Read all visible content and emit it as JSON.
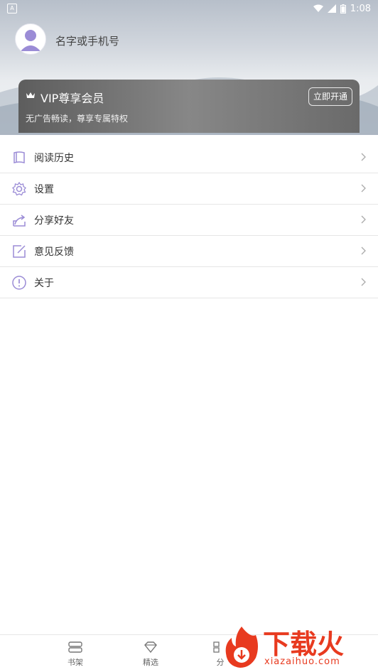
{
  "status_bar": {
    "time": "1:08",
    "app_badge": "A"
  },
  "profile": {
    "name": "名字或手机号"
  },
  "vip": {
    "title": "VIP尊享会员",
    "description": "无广告畅读，尊享专属特权",
    "button_label": "立即开通"
  },
  "menu": {
    "items": [
      {
        "label": "阅读历史",
        "icon": "book-icon"
      },
      {
        "label": "设置",
        "icon": "gear-icon"
      },
      {
        "label": "分享好友",
        "icon": "share-icon"
      },
      {
        "label": "意见反馈",
        "icon": "edit-icon"
      },
      {
        "label": "关于",
        "icon": "info-icon"
      }
    ]
  },
  "bottom_nav": {
    "items": [
      {
        "label": "书架",
        "icon": "bookshelf-icon"
      },
      {
        "label": "精选",
        "icon": "diamond-icon"
      },
      {
        "label": "分",
        "icon": "category-icon"
      }
    ]
  },
  "watermark": {
    "text": "下载火",
    "subtext": "xiazaihuo.com"
  },
  "colors": {
    "accent": "#9b8cd6",
    "watermark": "#e83a1f",
    "vip_card": "#7a7a7a"
  }
}
